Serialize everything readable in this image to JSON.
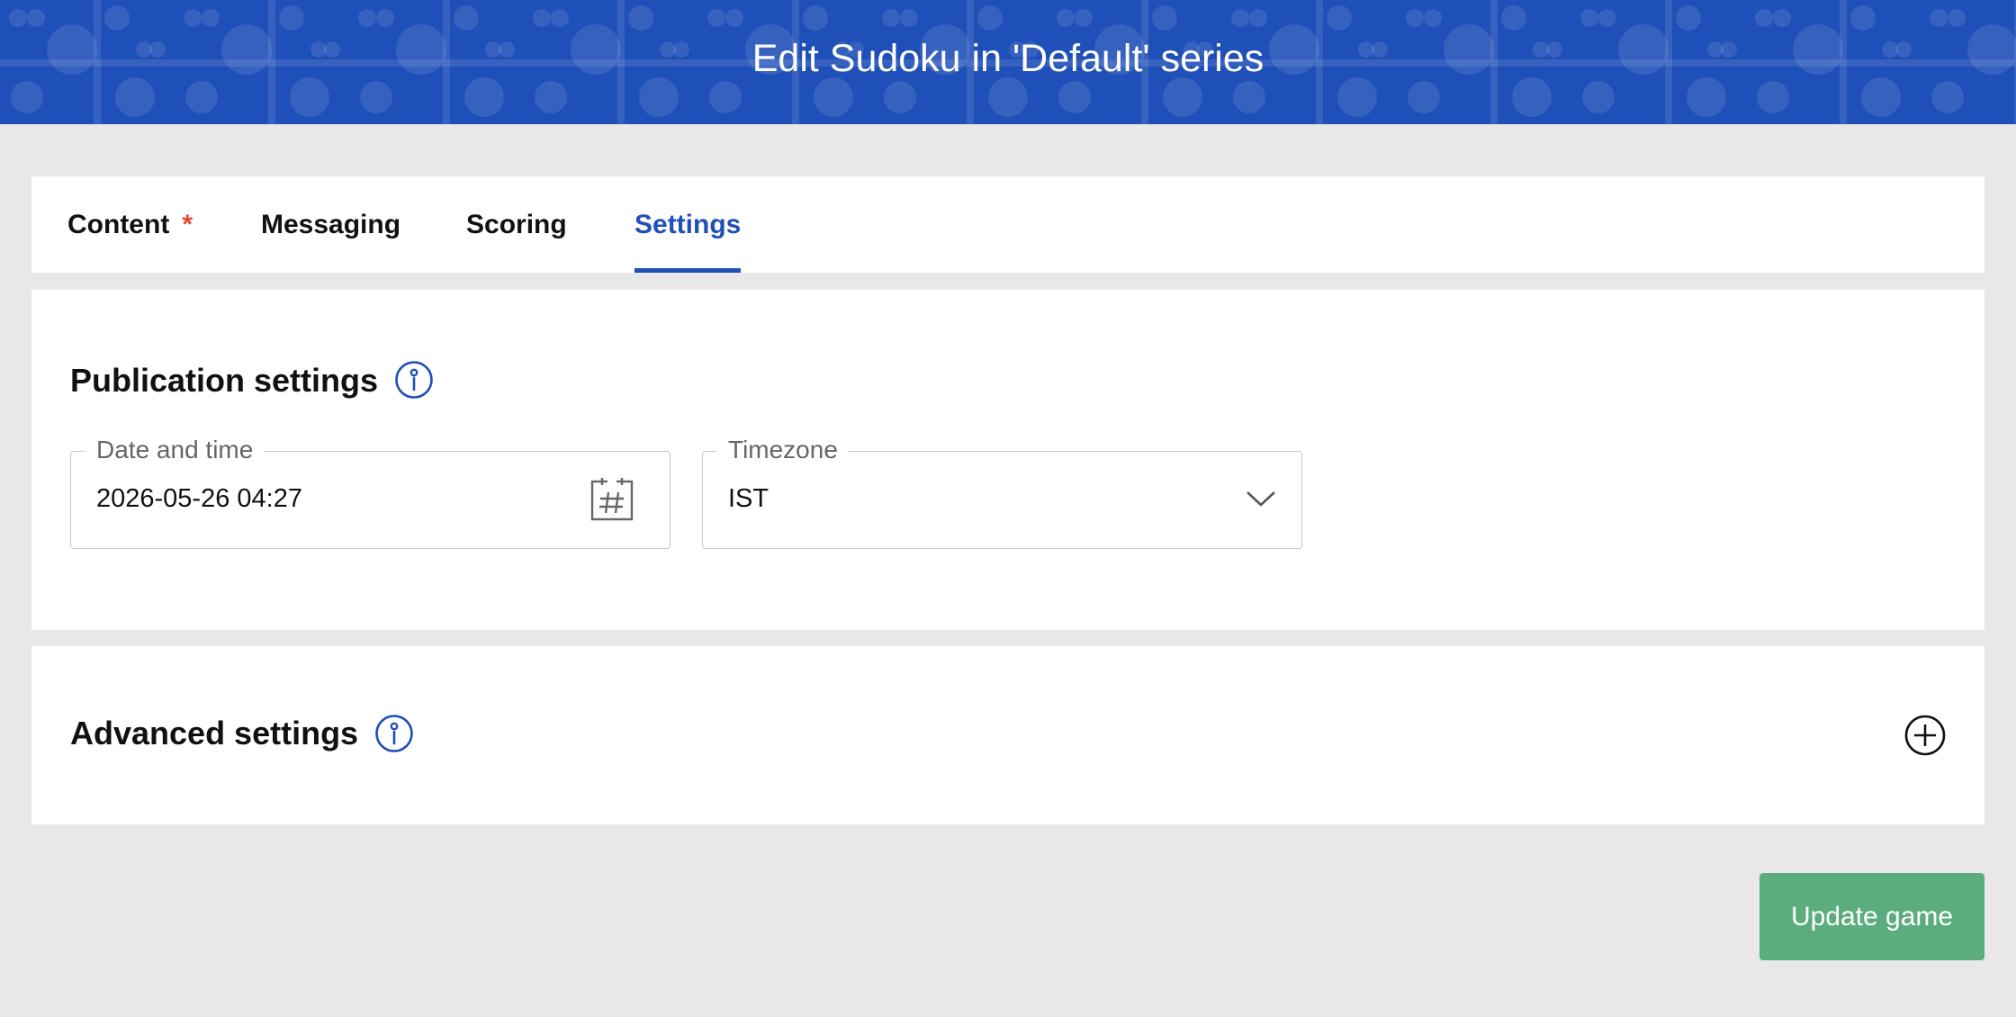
{
  "header": {
    "title": "Edit Sudoku in 'Default' series"
  },
  "tabs": [
    {
      "label": "Content",
      "required_mark": "*"
    },
    {
      "label": "Messaging"
    },
    {
      "label": "Scoring"
    },
    {
      "label": "Settings",
      "active": true
    }
  ],
  "publication": {
    "title": "Publication settings",
    "info_icon": "info-icon",
    "date_field": {
      "label": "Date and time",
      "value": "2026-05-26 04:27",
      "icon": "calendar-icon"
    },
    "timezone_field": {
      "label": "Timezone",
      "value": "IST",
      "icon": "chevron-down-icon"
    }
  },
  "advanced": {
    "title": "Advanced settings",
    "info_icon": "info-icon",
    "expand_icon": "plus-circle-icon"
  },
  "actions": {
    "update_label": "Update game"
  },
  "colors": {
    "brand_blue": "#1f4fb8",
    "required_red": "#e04a2f",
    "button_green": "#5cad7e",
    "page_bg": "#e8e8e8"
  }
}
